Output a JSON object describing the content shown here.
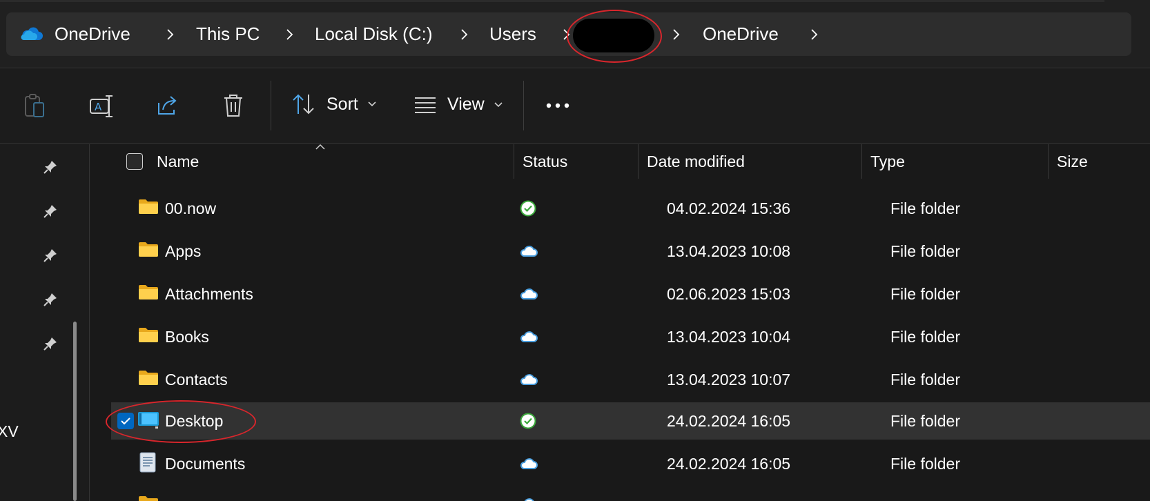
{
  "breadcrumb": {
    "items": [
      "OneDrive",
      "This PC",
      "Local Disk (C:)",
      "Users",
      "",
      "OneDrive"
    ]
  },
  "toolbar": {
    "sort_label": "Sort",
    "view_label": "View",
    "buttons": [
      "paste-icon",
      "rename-icon",
      "share-icon",
      "delete-icon",
      "sort-icon",
      "view-icon",
      "more-icon"
    ]
  },
  "nav": {
    "partial_label": "XV"
  },
  "columns": {
    "name": "Name",
    "status": "Status",
    "date": "Date modified",
    "type": "Type",
    "size": "Size"
  },
  "files": [
    {
      "name": "00.now",
      "status": "synced",
      "date": "04.02.2024 15:36",
      "type": "File folder",
      "icon": "folder-icon"
    },
    {
      "name": "Apps",
      "status": "cloud",
      "date": "13.04.2023 10:08",
      "type": "File folder",
      "icon": "folder-icon"
    },
    {
      "name": "Attachments",
      "status": "cloud",
      "date": "02.06.2023 15:03",
      "type": "File folder",
      "icon": "folder-icon"
    },
    {
      "name": "Books",
      "status": "cloud",
      "date": "13.04.2023 10:04",
      "type": "File folder",
      "icon": "folder-icon"
    },
    {
      "name": "Contacts",
      "status": "cloud",
      "date": "13.04.2023 10:07",
      "type": "File folder",
      "icon": "folder-icon"
    },
    {
      "name": "Desktop",
      "status": "synced",
      "date": "24.02.2024 16:05",
      "type": "File folder",
      "icon": "desktop-folder-icon",
      "selected": true
    },
    {
      "name": "Documents",
      "status": "cloud",
      "date": "24.02.2024 16:05",
      "type": "File folder",
      "icon": "documents-folder-icon"
    }
  ],
  "colors": {
    "accent": "#0067c0",
    "folder": "#f8c22b",
    "synced_green": "#3aa83a",
    "cloud_blue": "#4a9fe0",
    "annotation_red": "#d9262c"
  }
}
